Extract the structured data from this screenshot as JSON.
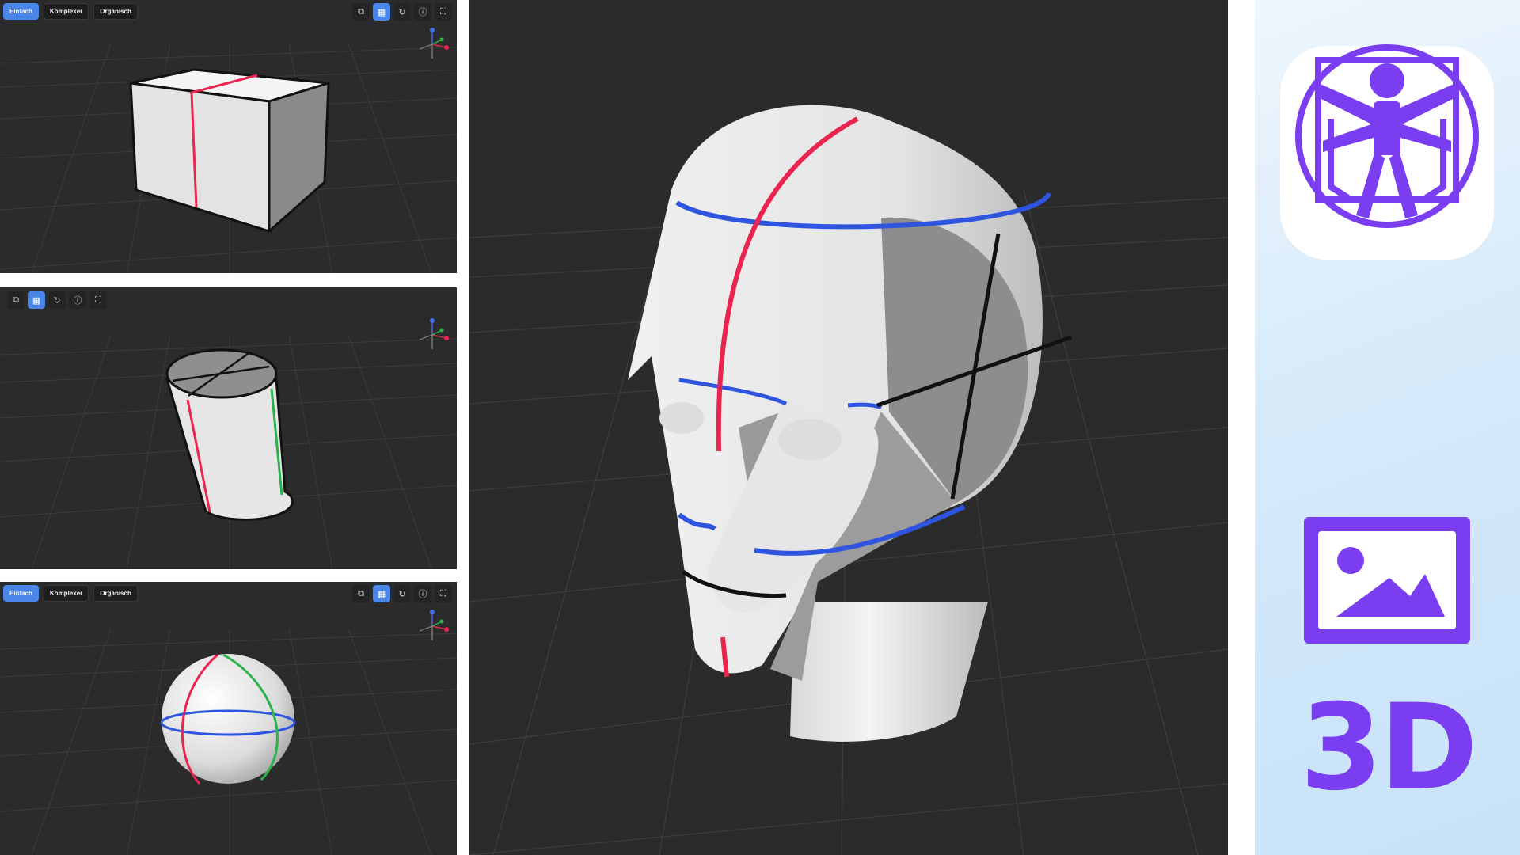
{
  "viewer_box": {
    "modes": [
      {
        "label": "Einfach",
        "active": true
      },
      {
        "label": "Komplexer",
        "active": false
      },
      {
        "label": "Organisch",
        "active": false
      }
    ],
    "tools": [
      "copy-icon",
      "grid-icon",
      "reset-icon",
      "info-icon",
      "fullscreen-icon"
    ]
  },
  "viewer_cylinder": {
    "tools": [
      "copy-icon",
      "grid-icon",
      "reset-icon",
      "info-icon",
      "fullscreen-icon"
    ]
  },
  "viewer_sphere": {
    "modes": [
      {
        "label": "Einfach",
        "active": true
      },
      {
        "label": "Komplexer",
        "active": false
      },
      {
        "label": "Organisch",
        "active": false
      }
    ],
    "tools": [
      "copy-icon",
      "grid-icon",
      "reset-icon",
      "info-icon",
      "fullscreen-icon"
    ]
  },
  "brand": {
    "label_3d": "3D",
    "colors": {
      "accent": "#7a3ef0",
      "highlight": "#4a86e8"
    }
  },
  "icons": {
    "copy": "⧉",
    "grid": "▦",
    "reset": "↻",
    "info": "ⓘ",
    "fullscreen": "⛶"
  }
}
